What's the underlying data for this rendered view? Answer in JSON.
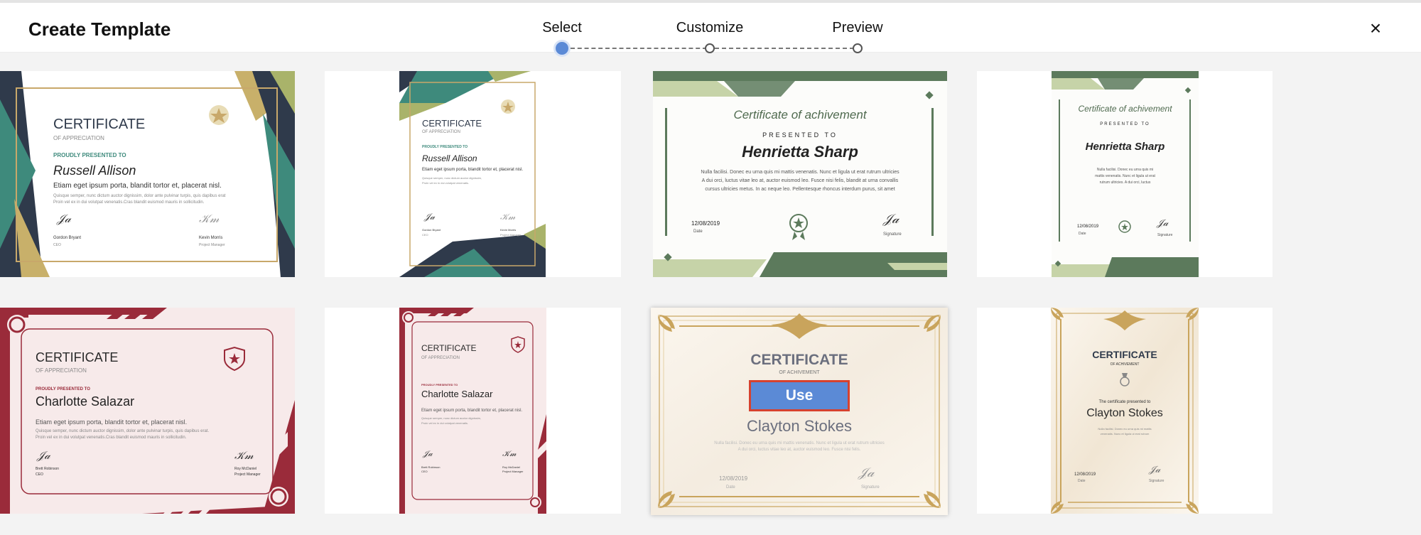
{
  "header": {
    "title": "Create Template",
    "close_icon": "×",
    "steps": [
      {
        "label": "Select",
        "state": "active"
      },
      {
        "label": "Customize",
        "state": "pending"
      },
      {
        "label": "Preview",
        "state": "pending"
      }
    ]
  },
  "templates": [
    {
      "heading": "CERTIFICATE",
      "sub": "OF APPRECIATION",
      "presented": "PROUDLY PRESENTED TO",
      "name": "Russell Allison",
      "body": "Etiam eget ipsum porta, blandit tortor et, placerat nisl.",
      "fine1": "Quisque semper, nunc dictum auctor dignissim, dolor ante pulvinar turpis, quis dapibus erat",
      "fine2": "Proin vel ex in dui volutpat venenatis.Cras blandit euismod mauris in sollicitudin.",
      "sig1_name": "Gordon Bryant",
      "sig1_role": "CEO",
      "sig2_name": "Kevin Morris",
      "sig2_role": "Project Manager"
    },
    {
      "heading": "CERTIFICATE",
      "sub": "OF APPRECIATION",
      "presented": "PROUDLY PRESENTED TO",
      "name": "Russell Allison",
      "body": "Etiam eget ipsum porta, blandit tortor et, placerat nisl.",
      "fine1": "Quisque semper, nunc dictum auctor dignissim,",
      "fine2": "Proin vel ex in dui volutpat venenatis.",
      "sig1_name": "Gordon Bryant",
      "sig1_role": "CEO",
      "sig2_name": "Kevin Morris",
      "sig2_role": "Project Manager"
    },
    {
      "heading": "Certificate of achivement",
      "presented": "PRESENTED TO",
      "name": "Henrietta Sharp",
      "fine1": "Nulla facilisi. Donec eu urna quis mi mattis venenatis. Nunc et ligula ut erat rutrum ultricies",
      "fine2": "A dui orci, luctus vitae leo at, auctor euismod leo. Fusce nisi felis, blandit at urna convallis",
      "fine3": "cursus ultricies metus. In ac neque leo. Pellentesque rhoncus interdum purus, sit amet",
      "date": "12/08/2019",
      "date_label": "Date",
      "sig_label": "Signature"
    },
    {
      "heading": "Certificate of achivement",
      "presented": "PRESENTED TO",
      "name": "Henrietta Sharp",
      "fine1": "Nulla facilisi. Donec eu urna quis mi",
      "fine2": "mattis venenatis. Nunc et ligula ut erat",
      "fine3": "rutrum ultricies. A dui orci, luctus",
      "date": "12/08/2019",
      "date_label": "Date",
      "sig_label": "Signature"
    },
    {
      "heading": "CERTIFICATE",
      "sub": "OF APPRECIATION",
      "presented": "PROUDLY PRESENTED TO",
      "name": "Charlotte Salazar",
      "body": "Etiam eget ipsum porta, blandit tortor et, placerat nisl.",
      "fine1": "Quisque semper, nunc dictum auctor dignissim, dolor ante pulvinar turpis, quis dapibus erat.",
      "fine2": "Proin vel ex in dui volutpat venenatis.Cras blandit euismod mauris in sollicitudin.",
      "sig1_name": "Brett Robinson",
      "sig1_role": "CEO",
      "sig2_name": "Roy McDaniel",
      "sig2_role": "Project Manager"
    },
    {
      "heading": "CERTIFICATE",
      "sub": "OF APPRECIATION",
      "presented": "PROUDLY PRESENTED TO",
      "name": "Charlotte Salazar",
      "body": "Etiam eget ipsum porta, blandit tortor et, placerat nisl.",
      "fine1": "Quisque semper, nunc dictum auctor dignissim,",
      "fine2": "Proin vel ex in dui volutpat venenatis.",
      "sig1_name": "Brett Robinson",
      "sig1_role": "CEO",
      "sig2_name": "Roy McDaniel",
      "sig2_role": "Project Manager"
    },
    {
      "heading": "CERTIFICATE",
      "sub": "OF ACHIVEMENT",
      "name": "Clayton Stokes",
      "fine1": "Nulla facilisi. Donec eu urna quis mi mattis venenatis. Nunc et ligula ut erat rutrum ultricies",
      "fine2": "A dui orci, luctus vitae leo at, auctor euismod leo. Fusce nisi felis.",
      "date": "12/08/2019",
      "date_label": "Date",
      "sig_label": "Signature",
      "use_label": "Use"
    },
    {
      "heading": "CERTIFICATE",
      "sub": "OF ACHIVEMENT",
      "presented": "The certificate presented to",
      "name": "Clayton Stokes",
      "fine1": "Nulla facilisi. Donec eu urna quis mi mattis",
      "fine2": "venenatis. Nunc et ligula ut erat rutrum",
      "date": "12/08/2019",
      "date_label": "Date",
      "sig_label": "Signature"
    }
  ],
  "colors": {
    "accent": "#5b8ad6",
    "use_border": "#d6422f",
    "navy": "#2f3a4b",
    "teal": "#3e8a7c",
    "olive": "#a9b36a",
    "gold": "#c8b06a",
    "sage": "#5c7a5c",
    "sage_light": "#c6d3a8",
    "maroon": "#9a2b3a",
    "pink_bg": "#f7eaea",
    "ornate_gold": "#c9a45c"
  }
}
